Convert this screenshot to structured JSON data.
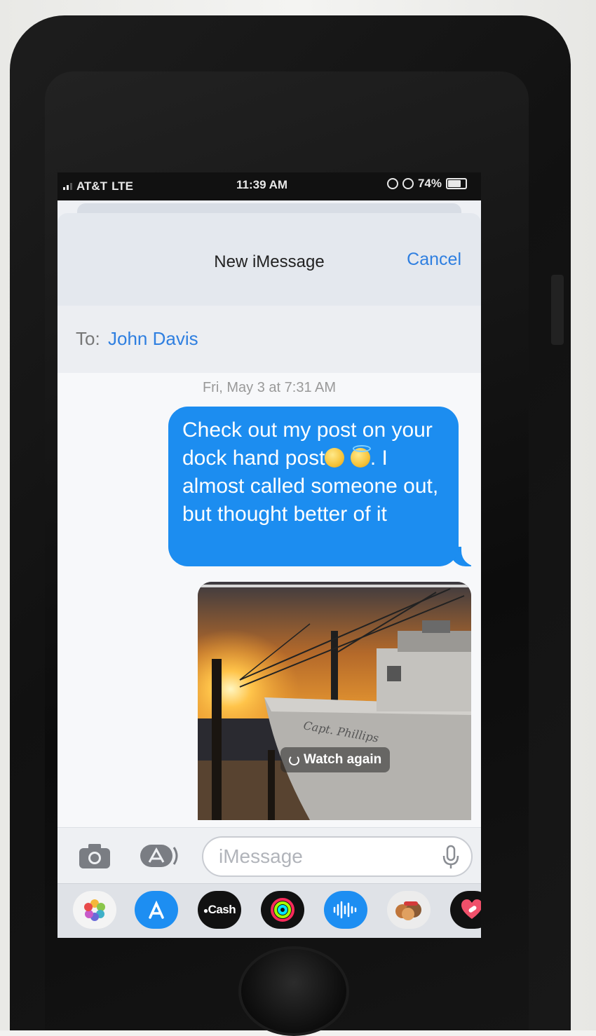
{
  "status_bar": {
    "carrier": "AT&T",
    "network": "LTE",
    "time": "11:39 AM",
    "battery": "74%"
  },
  "header": {
    "title": "New iMessage",
    "cancel_label": "Cancel"
  },
  "recipient": {
    "to_label": "To:",
    "name": "John Davis"
  },
  "conversation": {
    "timestamp": "Fri, May 3 at 7:31 AM",
    "message": {
      "part1": "Check out my post on your dock hand post",
      "part2": ". I almost called someone out, but thought better of it"
    },
    "video": {
      "boat_name": "Capt. Phillips",
      "watch_again_label": "Watch again"
    }
  },
  "compose": {
    "placeholder": "iMessage"
  },
  "app_drawer": {
    "apps": [
      {
        "icon": "photos-icon"
      },
      {
        "icon": "app-store-icon"
      },
      {
        "icon": "apple-cash-icon",
        "label": "Cash"
      },
      {
        "icon": "activity-icon"
      },
      {
        "icon": "audio-message-icon"
      },
      {
        "icon": "memoji-icon"
      },
      {
        "icon": "digital-touch-icon"
      }
    ]
  },
  "colors": {
    "imessage_blue": "#1c8df0",
    "link_blue": "#2f7fe0"
  }
}
